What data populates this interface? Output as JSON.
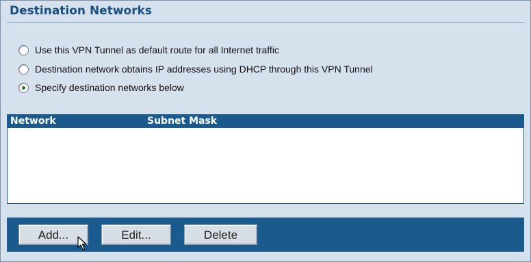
{
  "section": {
    "title": "Destination Networks"
  },
  "routing_options": [
    {
      "label": "Use this VPN Tunnel as default route for all Internet traffic",
      "selected": false
    },
    {
      "label": "Destination network obtains IP addresses using DHCP through this VPN Tunnel",
      "selected": false
    },
    {
      "label": "Specify destination networks below",
      "selected": true
    }
  ],
  "networks_table": {
    "columns": [
      "Network",
      "Subnet Mask"
    ],
    "rows": []
  },
  "buttons": {
    "add": "Add...",
    "edit": "Edit...",
    "delete": "Delete"
  },
  "colors": {
    "panel_bg": "#d6e1ee",
    "header_bar": "#1a5a8c",
    "title_text": "#1a4f7f",
    "selected_radio": "#1d7a2a"
  },
  "icons": {
    "cursor": "mouse-pointer-icon"
  }
}
